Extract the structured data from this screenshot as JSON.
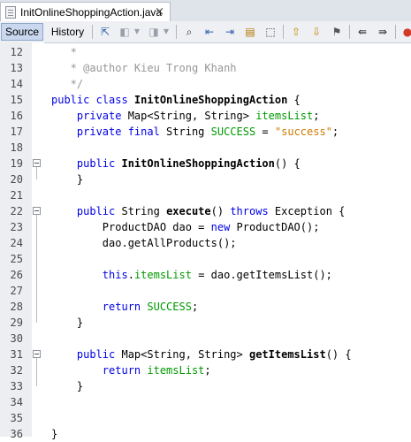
{
  "tab": {
    "title": "InitOnlineShoppingAction.java",
    "close_glyph": "×"
  },
  "toolbar": {
    "source_label": "Source",
    "history_label": "History",
    "icons": [
      "last-edit-icon",
      "back-icon",
      "dropdown-icon",
      "forward-icon",
      "dropdown-icon",
      "find-icon",
      "find-previous-icon",
      "find-next-icon",
      "toggle-highlight-icon",
      "toggle-rect-select-icon",
      "previous-bookmark-icon",
      "next-bookmark-icon",
      "toggle-bookmark-icon",
      "shift-left-icon",
      "shift-right-icon",
      "stop-macro-icon"
    ]
  },
  "colors": {
    "keyword": "#0000e6",
    "comment": "#969696",
    "string": "#ce7b00",
    "field": "#009900"
  },
  "editor": {
    "lines": [
      {
        "no": "12",
        "segs": [
          {
            "t": "   *",
            "c": "cmt"
          }
        ]
      },
      {
        "no": "13",
        "segs": [
          {
            "t": "   * @author Kieu Trong Khanh",
            "c": "cmt"
          }
        ]
      },
      {
        "no": "14",
        "segs": [
          {
            "t": "   */",
            "c": "cmt"
          }
        ]
      },
      {
        "no": "15",
        "segs": [
          {
            "t": "public class ",
            "c": "kw"
          },
          {
            "t": "InitOnlineShoppingAction",
            "c": "bold"
          },
          {
            "t": " {",
            "c": ""
          }
        ]
      },
      {
        "no": "16",
        "segs": [
          {
            "t": "    private ",
            "c": "kw"
          },
          {
            "t": "Map<String, String> ",
            "c": ""
          },
          {
            "t": "itemsList",
            "c": "fld"
          },
          {
            "t": ";",
            "c": ""
          }
        ]
      },
      {
        "no": "17",
        "segs": [
          {
            "t": "    private final ",
            "c": "kw"
          },
          {
            "t": "String ",
            "c": ""
          },
          {
            "t": "SUCCESS",
            "c": "fld"
          },
          {
            "t": " = ",
            "c": ""
          },
          {
            "t": "\"success\"",
            "c": "str"
          },
          {
            "t": ";",
            "c": ""
          }
        ]
      },
      {
        "no": "18",
        "segs": []
      },
      {
        "no": "19",
        "segs": [
          {
            "t": "    public ",
            "c": "kw"
          },
          {
            "t": "InitOnlineShoppingAction",
            "c": "bold"
          },
          {
            "t": "() {",
            "c": ""
          }
        ]
      },
      {
        "no": "20",
        "segs": [
          {
            "t": "    }",
            "c": ""
          }
        ]
      },
      {
        "no": "21",
        "segs": []
      },
      {
        "no": "22",
        "segs": [
          {
            "t": "    public ",
            "c": "kw"
          },
          {
            "t": "String ",
            "c": ""
          },
          {
            "t": "execute",
            "c": "bold"
          },
          {
            "t": "() ",
            "c": ""
          },
          {
            "t": "throws",
            "c": "kw"
          },
          {
            "t": " Exception {",
            "c": ""
          }
        ]
      },
      {
        "no": "23",
        "segs": [
          {
            "t": "        ProductDAO dao = ",
            "c": ""
          },
          {
            "t": "new",
            "c": "kw"
          },
          {
            "t": " ProductDAO();",
            "c": ""
          }
        ]
      },
      {
        "no": "24",
        "segs": [
          {
            "t": "        dao.getAllProducts();",
            "c": ""
          }
        ]
      },
      {
        "no": "25",
        "segs": []
      },
      {
        "no": "26",
        "segs": [
          {
            "t": "        this",
            "c": "kw"
          },
          {
            "t": ".",
            "c": ""
          },
          {
            "t": "itemsList",
            "c": "fld"
          },
          {
            "t": " = dao.getItemsList();",
            "c": ""
          }
        ]
      },
      {
        "no": "27",
        "segs": []
      },
      {
        "no": "28",
        "segs": [
          {
            "t": "        return ",
            "c": "kw"
          },
          {
            "t": "SUCCESS",
            "c": "fld"
          },
          {
            "t": ";",
            "c": ""
          }
        ]
      },
      {
        "no": "29",
        "segs": [
          {
            "t": "    }",
            "c": ""
          }
        ]
      },
      {
        "no": "30",
        "segs": []
      },
      {
        "no": "31",
        "segs": [
          {
            "t": "    public ",
            "c": "kw"
          },
          {
            "t": "Map<String, String> ",
            "c": ""
          },
          {
            "t": "getItemsList",
            "c": "bold"
          },
          {
            "t": "() {",
            "c": ""
          }
        ]
      },
      {
        "no": "32",
        "segs": [
          {
            "t": "        return ",
            "c": "kw"
          },
          {
            "t": "itemsList",
            "c": "fld"
          },
          {
            "t": ";",
            "c": ""
          }
        ]
      },
      {
        "no": "33",
        "segs": [
          {
            "t": "    }",
            "c": ""
          }
        ]
      },
      {
        "no": "34",
        "segs": []
      },
      {
        "no": "35",
        "segs": []
      },
      {
        "no": "36",
        "segs": [
          {
            "t": "}",
            "c": ""
          }
        ]
      }
    ],
    "fold_markers_at": [
      "19",
      "22",
      "31"
    ]
  }
}
